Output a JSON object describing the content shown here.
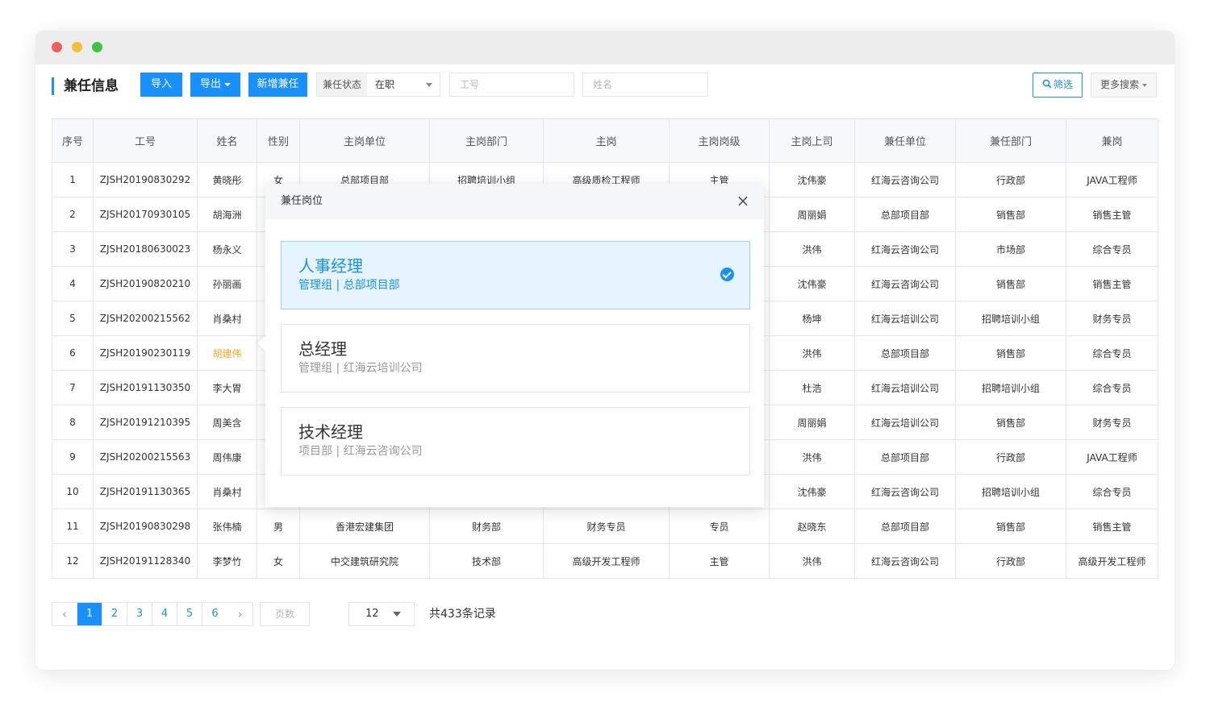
{
  "header": {
    "title": "兼任信息",
    "import_label": "导入",
    "export_label": "导出",
    "add_label": "新增兼任",
    "status_label": "兼任状态",
    "status_value": "在职",
    "employee_no_placeholder": "工号",
    "name_placeholder": "姓名",
    "filter_label": "筛选",
    "more_search_label": "更多搜索"
  },
  "table": {
    "columns": [
      "序号",
      "工号",
      "姓名",
      "性别",
      "主岗单位",
      "主岗部门",
      "主岗",
      "主岗岗级",
      "主岗上司",
      "兼任单位",
      "兼任部门",
      "兼岗"
    ],
    "rows": [
      [
        "1",
        "ZJSH20190830292",
        "黄晓彤",
        "女",
        "总部项目部",
        "招聘培训小组",
        "高级质检工程师",
        "主管",
        "沈伟豪",
        "红海云咨询公司",
        "行政部",
        "JAVA工程师"
      ],
      [
        "2",
        "ZJSH20170930105",
        "胡海洲",
        "",
        "",
        "",
        "",
        "",
        "周丽娟",
        "总部项目部",
        "销售部",
        "销售主管"
      ],
      [
        "3",
        "ZJSH20180630023",
        "杨永义",
        "",
        "",
        "",
        "",
        "",
        "洪伟",
        "红海云咨询公司",
        "市场部",
        "综合专员"
      ],
      [
        "4",
        "ZJSH20190820210",
        "孙丽画",
        "",
        "",
        "",
        "",
        "",
        "沈伟豪",
        "红海云咨询公司",
        "销售部",
        "销售主管"
      ],
      [
        "5",
        "ZJSH20200215562",
        "肖桑村",
        "",
        "",
        "",
        "",
        "",
        "杨坤",
        "红海云培训公司",
        "招聘培训小组",
        "财务专员"
      ],
      [
        "6",
        "ZJSH20190230119",
        "胡建伟",
        "",
        "",
        "",
        "",
        "",
        "洪伟",
        "总部项目部",
        "销售部",
        "综合专员"
      ],
      [
        "7",
        "ZJSH20191130350",
        "李大胃",
        "",
        "",
        "",
        "",
        "",
        "杜浩",
        "红海云培训公司",
        "招聘培训小组",
        "综合专员"
      ],
      [
        "8",
        "ZJSH20191210395",
        "周美含",
        "",
        "",
        "",
        "",
        "",
        "周丽娟",
        "红海云培训公司",
        "销售部",
        "财务专员"
      ],
      [
        "9",
        "ZJSH20200215563",
        "周伟康",
        "",
        "",
        "",
        "",
        "",
        "洪伟",
        "总部项目部",
        "行政部",
        "JAVA工程师"
      ],
      [
        "10",
        "ZJSH20191130365",
        "肖桑村",
        "",
        "",
        "",
        "",
        "",
        "沈伟豪",
        "红海云咨询公司",
        "招聘培训小组",
        "综合专员"
      ],
      [
        "11",
        "ZJSH20190830298",
        "张伟楠",
        "男",
        "香港宏建集团",
        "财务部",
        "财务专员",
        "专员",
        "赵晓东",
        "总部项目部",
        "销售部",
        "销售主管"
      ],
      [
        "12",
        "ZJSH20191128340",
        "李梦竹",
        "女",
        "中交建筑研究院",
        "技术部",
        "高级开发工程师",
        "主管",
        "洪伟",
        "红海云咨询公司",
        "行政部",
        "高级开发工程师"
      ]
    ],
    "highlight_row_index": 5
  },
  "popup": {
    "title": "兼任岗位",
    "close_glyph": "×",
    "options": [
      {
        "title": "人事经理",
        "subtitle": "管理组 | 总部项目部",
        "selected": true
      },
      {
        "title": "总经理",
        "subtitle": "管理组 | 红海云培训公司",
        "selected": false
      },
      {
        "title": "技术经理",
        "subtitle": "项目部 | 红海云咨询公司",
        "selected": false
      }
    ]
  },
  "pagination": {
    "prev_glyph": "‹",
    "next_glyph": "›",
    "pages": [
      "1",
      "2",
      "3",
      "4",
      "5",
      "6"
    ],
    "current_page": "1",
    "page_input_placeholder": "页数",
    "page_size": "12",
    "total_text": "共433条记录"
  },
  "colors": {
    "accent": "#1890ff",
    "highlight_name": "#f5a623"
  }
}
